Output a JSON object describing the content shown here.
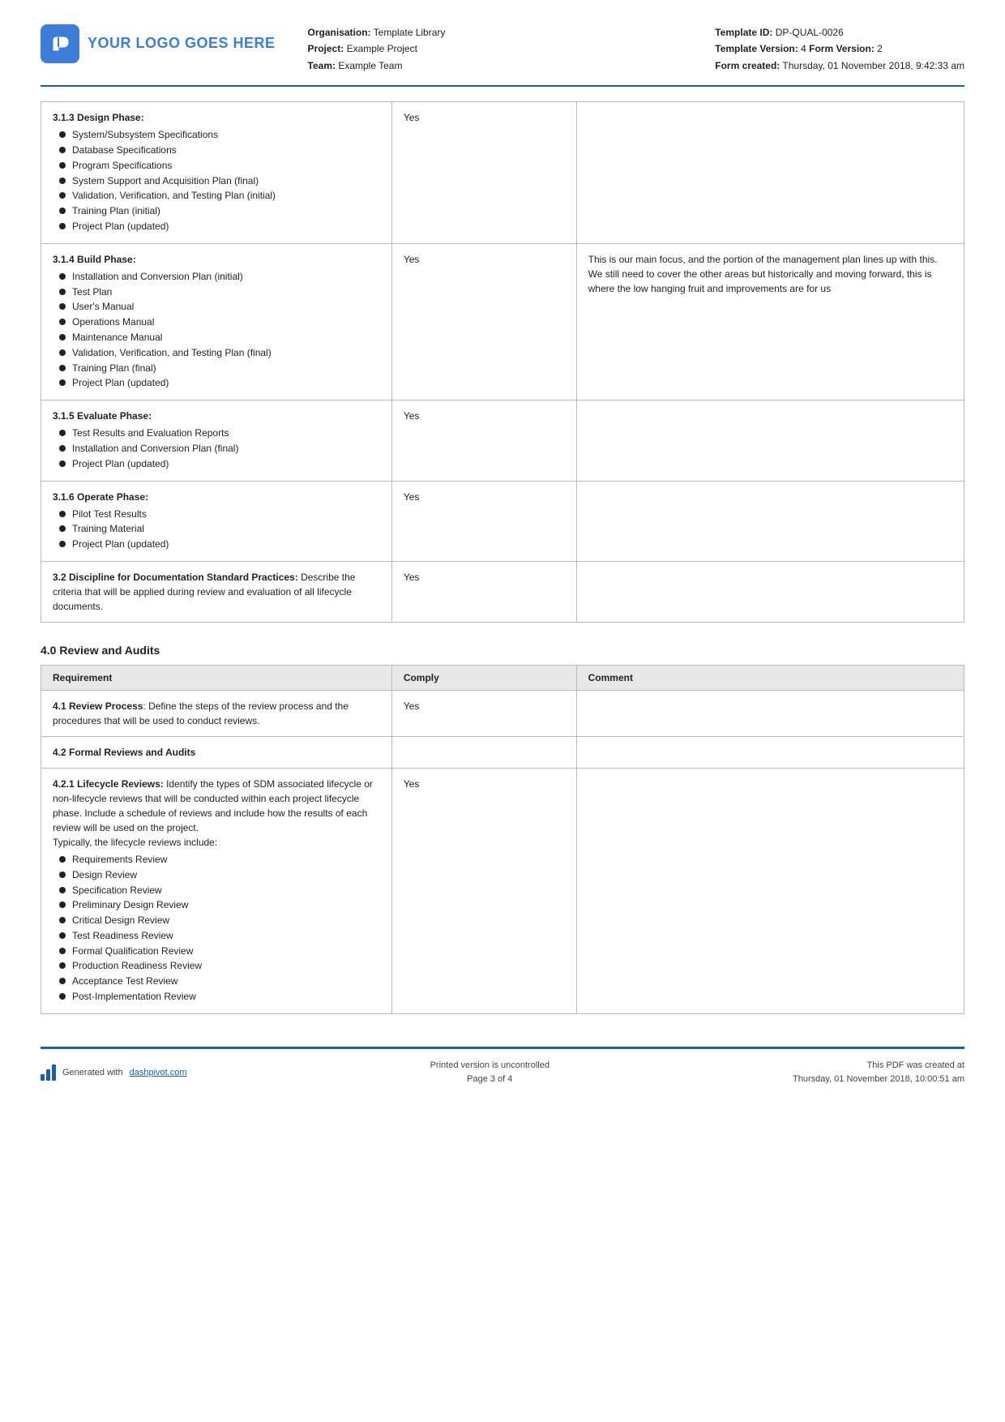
{
  "header": {
    "logo_text": "YOUR LOGO GOES HERE",
    "org_label": "Organisation:",
    "org_value": "Template Library",
    "project_label": "Project:",
    "project_value": "Example Project",
    "team_label": "Team:",
    "team_value": "Example Team",
    "template_id_label": "Template ID:",
    "template_id_value": "DP-QUAL-0026",
    "template_version_label": "Template Version:",
    "template_version_value": "4",
    "form_version_label": "Form Version:",
    "form_version_value": "2",
    "form_created_label": "Form created:",
    "form_created_value": "Thursday, 01 November 2018, 9:42:33 am"
  },
  "sections": [
    {
      "id": "3_1_3",
      "title": "3.1.3 Design Phase:",
      "bullets": [
        "System/Subsystem Specifications",
        "Database Specifications",
        "Program Specifications",
        "System Support and Acquisition Plan (final)",
        "Validation, Verification, and Testing Plan (initial)",
        "Training Plan (initial)",
        "Project Plan (updated)"
      ],
      "comply": "Yes",
      "comment": ""
    },
    {
      "id": "3_1_4",
      "title": "3.1.4 Build Phase:",
      "bullets": [
        "Installation and Conversion Plan (initial)",
        "Test Plan",
        "User's Manual",
        "Operations Manual",
        "Maintenance Manual",
        "Validation, Verification, and Testing Plan (final)",
        "Training Plan (final)",
        "Project Plan (updated)"
      ],
      "comply": "Yes",
      "comment": "This is our main focus, and the portion of the management plan lines up with this. We still need to cover the other areas but historically and moving forward, this is where the low hanging fruit and improvements are for us"
    },
    {
      "id": "3_1_5",
      "title": "3.1.5 Evaluate Phase:",
      "bullets": [
        "Test Results and Evaluation Reports",
        "Installation and Conversion Plan (final)",
        "Project Plan (updated)"
      ],
      "comply": "Yes",
      "comment": ""
    },
    {
      "id": "3_1_6",
      "title": "3.1.6 Operate Phase:",
      "bullets": [
        "Pilot Test Results",
        "Training Material",
        "Project Plan (updated)"
      ],
      "comply": "Yes",
      "comment": ""
    },
    {
      "id": "3_2",
      "title": "3.2 Discipline for Documentation Standard Practices:",
      "description": "Describe the criteria that will be applied during review and evaluation of all lifecycle documents.",
      "bullets": [],
      "comply": "Yes",
      "comment": ""
    }
  ],
  "review_section": {
    "heading": "4.0 Review and Audits",
    "table_headers": {
      "requirement": "Requirement",
      "comply": "Comply",
      "comment": "Comment"
    },
    "rows": [
      {
        "id": "4_1",
        "requirement_bold": "4.1 Review Process",
        "requirement_text": ": Define the steps of the review process and the procedures that will be used to conduct reviews.",
        "comply": "Yes",
        "comment": ""
      },
      {
        "id": "4_2",
        "requirement_bold": "4.2 Formal Reviews and Audits",
        "requirement_text": "",
        "comply": "",
        "comment": ""
      },
      {
        "id": "4_2_1",
        "requirement_bold": "4.2.1 Lifecycle Reviews:",
        "requirement_text": " Identify the types of SDM associated lifecycle or non-lifecycle reviews that will be conducted within each project lifecycle phase. Include a schedule of reviews and include how the results of each review will be used on the project.\nTypically, the lifecycle reviews include:",
        "comply": "Yes",
        "comment": "",
        "bullets": [
          "Requirements Review",
          "Design Review",
          "Specification Review",
          "Preliminary Design Review",
          "Critical Design Review",
          "Test Readiness Review",
          "Formal Qualification Review",
          "Production Readiness Review",
          "Acceptance Test Review",
          "Post-Implementation Review"
        ]
      }
    ]
  },
  "footer": {
    "generated_text": "Generated with ",
    "generated_link": "dashpivot.com",
    "center_line1": "Printed version is uncontrolled",
    "center_line2": "Page 3 of 4",
    "right_line1": "This PDF was created at",
    "right_line2": "Thursday, 01 November 2018, 10:00:51 am"
  }
}
